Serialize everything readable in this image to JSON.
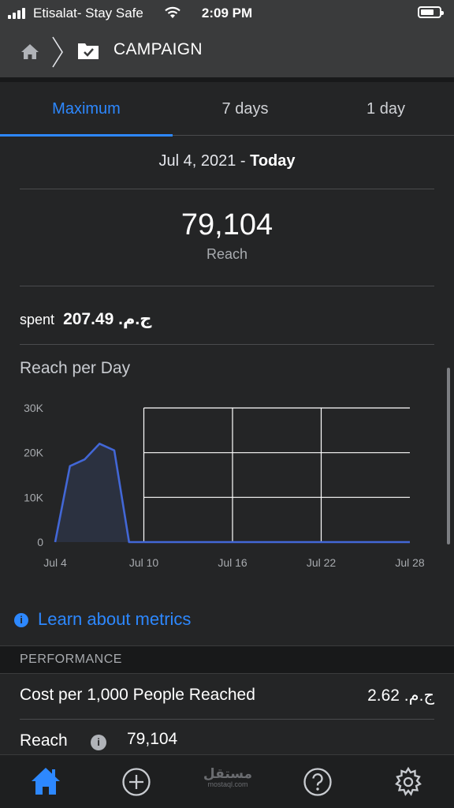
{
  "status_bar": {
    "carrier": "Etisalat- Stay Safe",
    "time": "2:09 PM"
  },
  "nav": {
    "title": "CAMPAIGN"
  },
  "tabs": [
    {
      "label": "Maximum",
      "active": true
    },
    {
      "label": "7 days",
      "active": false
    },
    {
      "label": "1 day",
      "active": false
    }
  ],
  "date_range": {
    "start": "Jul 4, 2021",
    "separator": " - ",
    "end": "Today"
  },
  "summary": {
    "value": "79,104",
    "label": "Reach"
  },
  "spent": {
    "label": "spent",
    "amount": "ج.م. 207.49"
  },
  "chart_title": "Reach per Day",
  "chart_data": {
    "type": "area",
    "title": "Reach per Day",
    "xlabel": "",
    "ylabel": "",
    "x_ticks": [
      "Jul 4",
      "Jul 10",
      "Jul 16",
      "Jul 22",
      "Jul 28"
    ],
    "y_ticks": [
      "0",
      "10K",
      "20K",
      "30K"
    ],
    "ylim": [
      0,
      30000
    ],
    "x_range_days": [
      0,
      24
    ],
    "series": [
      {
        "x_days_since_jul4": [
          0,
          1,
          2,
          3,
          4,
          5,
          6,
          7,
          8,
          9,
          10,
          11,
          12,
          13,
          14,
          15,
          16,
          17,
          18,
          19,
          20,
          21,
          22,
          23,
          24
        ],
        "values": [
          0,
          17000,
          18500,
          22000,
          20500,
          0,
          0,
          0,
          0,
          0,
          0,
          0,
          0,
          0,
          0,
          0,
          0,
          0,
          0,
          0,
          0,
          0,
          0,
          0,
          0
        ]
      }
    ],
    "grid": true,
    "colors": {
      "line": "#4267d6",
      "fill": "#2b3140",
      "grid": "#ffffff"
    }
  },
  "learn_link": "Learn about metrics",
  "performance": {
    "header": "PERFORMANCE",
    "rows": [
      {
        "label": "Cost per 1,000 People Reached",
        "value": "ج.م. 2.62"
      },
      {
        "label": "Reach",
        "value": "79,104"
      }
    ]
  },
  "watermark": {
    "arabic": "مستقل",
    "latin": "mostaql.com"
  },
  "bottom_nav": [
    {
      "icon": "home-icon",
      "active": true
    },
    {
      "icon": "add-circle-icon",
      "active": false
    },
    {
      "icon": "help-icon",
      "active": false
    },
    {
      "icon": "settings-icon",
      "active": false
    }
  ],
  "accent_color": "#2d88ff"
}
